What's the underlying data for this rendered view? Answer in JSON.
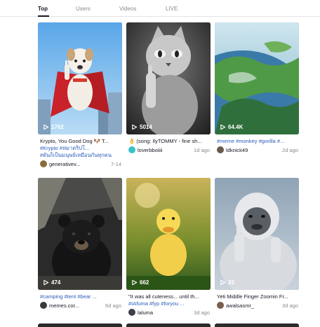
{
  "tabs": [
    "Top",
    "Users",
    "Videos",
    "LIVE"
  ],
  "videos": [
    {
      "views": "1762",
      "line1": "Krypto, You Good Dog 🐶 T...",
      "line2": "#Krypto #หมาคริปโ...",
      "line3": "#ดันก็เป็นมนุษย์เหมือนกันทุกคน",
      "user": "generativev...",
      "date": "7-14"
    },
    {
      "views": "5014",
      "line1": "👌 (song: IlyTOMMY - fine sh...",
      "line2": "",
      "line3": "",
      "user": "loverbboiiii",
      "date": "1d ago"
    },
    {
      "views": "64.4K",
      "line1": "",
      "line2": "#meme #monkey #gorilla #...",
      "line3": "",
      "user": "ldknick49",
      "date": "2d ago"
    },
    {
      "views": "474",
      "line1": "",
      "line2": "#camping #tent #bear ...",
      "line3": "",
      "user": "memes.cor...",
      "date": "6d ago"
    },
    {
      "views": "662",
      "line1": "\"It was all cuteness... until th...",
      "line2": "#IAfuma #fyp #foryou ...",
      "line3": "",
      "user": "laluma",
      "date": "3d ago"
    },
    {
      "views": "33",
      "line1": "Yeti Middle Finger Zoomin Fr...",
      "line2": "",
      "line3": "",
      "user": "awalsasmr_",
      "date": "3d ago"
    }
  ],
  "colors": {
    "accent_text": "#161823",
    "hashtag": "#2b5db9",
    "muted": "#8a8b91"
  },
  "icons": {
    "views": "play-icon"
  }
}
